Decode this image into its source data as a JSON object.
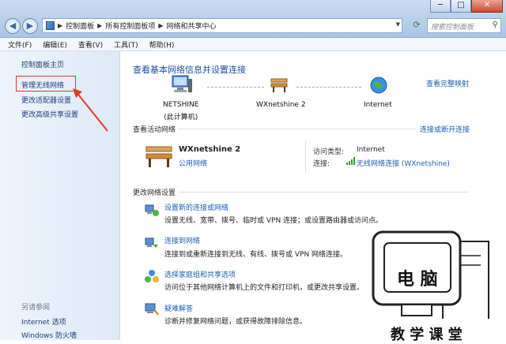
{
  "window": {
    "minimize": "─",
    "maximize": "□",
    "close": "✕"
  },
  "nav": {
    "back": "◀",
    "forward": "▶",
    "breadcrumb": [
      "控制面板",
      "所有控制面板项",
      "网络和共享中心"
    ],
    "search_placeholder": "搜索控制面板"
  },
  "menu": [
    "文件(F)",
    "编辑(E)",
    "查看(V)",
    "工具(T)",
    "帮助(H)"
  ],
  "sidebar": {
    "items": [
      "控制面板主页",
      "管理无线网络",
      "更改适配器设置",
      "更改高级共享设置"
    ],
    "see_also_title": "另请参阅",
    "see_also": [
      "Internet 选项",
      "Windows 防火墙"
    ]
  },
  "main": {
    "title": "查看基本网络信息并设置连接",
    "full_map_link": "查看完整映射",
    "nodes": [
      {
        "name": "NETSHINE",
        "sub": "(此计算机)"
      },
      {
        "name": "WXnetshine  2",
        "sub": ""
      },
      {
        "name": "Internet",
        "sub": ""
      }
    ],
    "active_title": "查看活动网络",
    "connect_link": "连接或断开连接",
    "active": {
      "name": "WXnetshine  2",
      "type": "公用网络",
      "access_label": "访问类型:",
      "access_value": "Internet",
      "conn_label": "连接:",
      "conn_value": "无线网络连接 (WXnetshine)"
    },
    "change_title": "更改网络设置",
    "tasks": [
      {
        "icon": "network-setup-icon",
        "title": "设置新的连接或网络",
        "desc": "设置无线、宽带、拨号、临时或 VPN 连接；或设置路由器或访问点。"
      },
      {
        "icon": "connect-network-icon",
        "title": "连接到网络",
        "desc": "连接到或重新连接到无线、有线、拨号或 VPN 网络连接。"
      },
      {
        "icon": "homegroup-icon",
        "title": "选择家庭组和共享选项",
        "desc": "访问位于其他网络计算机上的文件和打印机，或更改共享设置。"
      },
      {
        "icon": "troubleshoot-icon",
        "title": "疑难解答",
        "desc": "诊断并修复网络问题，或获得故障排除信息。"
      }
    ]
  },
  "watermark": {
    "line1": "电 脑",
    "line2": "教 学 课 堂"
  },
  "colors": {
    "link": "#1a5fb4",
    "highlight": "#e23a2a",
    "wifi": "#2fa82f"
  }
}
